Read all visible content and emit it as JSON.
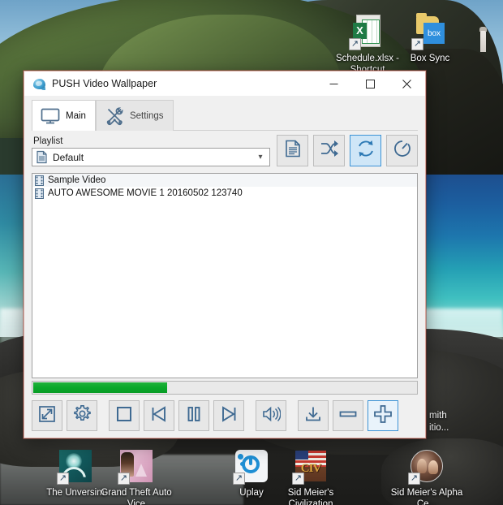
{
  "desktop": {
    "icons": [
      {
        "name": "Schedule.xlsx - Shortcut",
        "icon": "excel-file-icon",
        "shortcut": true
      },
      {
        "name": "Box Sync",
        "icon": "box-sync-folder-icon",
        "shortcut": true
      },
      {
        "name": "The Unversim",
        "icon": "universim-game-icon",
        "shortcut": true
      },
      {
        "name": "Grand Theft Auto Vice",
        "icon": "gta-vice-game-icon",
        "shortcut": true
      },
      {
        "name": "Uplay",
        "icon": "uplay-icon",
        "shortcut": true
      },
      {
        "name": "Sid Meier's Civilization",
        "icon": "civilization-game-icon",
        "shortcut": true
      },
      {
        "name": "Sid Meier's Alpha Ce...",
        "icon": "alpha-centauri-game-icon",
        "shortcut": true
      },
      {
        "name": "...mith\n...itio...",
        "icon": "obscured-icon",
        "shortcut": true
      }
    ],
    "occluded_label_line1": "mith",
    "occluded_label_line2": "itio..."
  },
  "window": {
    "title": "PUSH Video Wallpaper",
    "app_icon": "push-video-wallpaper-globe-icon",
    "controls": {
      "minimize": "minimize-button",
      "maximize": "maximize-button",
      "close": "close-button"
    },
    "border_color": "#d9a8a0"
  },
  "tabs": [
    {
      "label": "Main",
      "icon": "monitor-icon",
      "active": true
    },
    {
      "label": "Settings",
      "icon": "wrench-screwdriver-icon",
      "active": false
    }
  ],
  "playlist": {
    "label": "Playlist",
    "selected": "Default",
    "icon": "playlist-file-icon",
    "options": [
      "Default"
    ],
    "dropdown_arrow": "chevron-down-icon"
  },
  "toolbar": [
    {
      "name": "playlist-manager-button",
      "icon": "document-lines-icon",
      "active": false
    },
    {
      "name": "shuffle-button",
      "icon": "shuffle-icon",
      "active": false
    },
    {
      "name": "repeat-button",
      "icon": "repeat-loop-icon",
      "active": true
    },
    {
      "name": "timer-button",
      "icon": "timer-clock-icon",
      "active": false
    }
  ],
  "list": {
    "items": [
      {
        "title": "Sample Video",
        "icon": "film-strip-icon"
      },
      {
        "title": "AUTO AWESOME MOVIE 1 20160502 123740",
        "icon": "film-strip-icon"
      }
    ]
  },
  "progress": {
    "percent": 35,
    "color": "#0aa82a"
  },
  "controls": [
    {
      "name": "fullscreen-button",
      "icon": "expand-arrows-icon",
      "active": false
    },
    {
      "name": "settings-button",
      "icon": "gear-icon",
      "active": false
    },
    {
      "name": "stop-button",
      "icon": "stop-square-icon",
      "active": false
    },
    {
      "name": "previous-button",
      "icon": "skip-backward-icon",
      "active": false
    },
    {
      "name": "pause-button",
      "icon": "pause-icon",
      "active": false
    },
    {
      "name": "next-button",
      "icon": "skip-forward-icon",
      "active": false
    },
    {
      "name": "volume-button",
      "icon": "speaker-volume-icon",
      "active": false
    },
    {
      "name": "download-button",
      "icon": "download-arrow-icon",
      "active": false
    },
    {
      "name": "remove-button",
      "icon": "minus-icon",
      "active": false
    },
    {
      "name": "add-button",
      "icon": "plus-icon",
      "active": true
    }
  ],
  "accent_color": "#3d93d6",
  "icon_stroke_color": "#3f6a92"
}
